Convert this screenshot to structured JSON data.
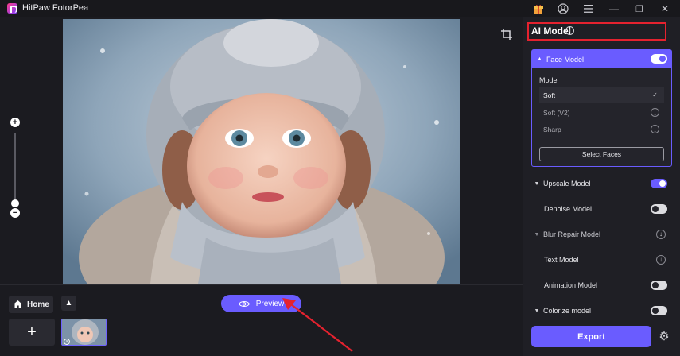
{
  "window": {
    "title": "HitPaw FotorPea",
    "minimize_glyph": "—",
    "restore_glyph": "❐",
    "close_glyph": "✕"
  },
  "canvas": {
    "zoom_in_glyph": "+",
    "zoom_out_glyph": "−",
    "photo_alt": "child in knit hat"
  },
  "bottom": {
    "home_label": "Home",
    "up_glyph": "▲",
    "add_glyph": "+",
    "preview_label": "Preview"
  },
  "panel": {
    "title": "AI Model",
    "info_glyph": "i",
    "face_model": {
      "label": "Face Model",
      "enabled": true,
      "mode_label": "Mode",
      "modes": [
        {
          "label": "Soft",
          "selected": true,
          "icon": "check-icon",
          "glyph": "✓"
        },
        {
          "label": "Soft (V2)",
          "selected": false,
          "icon": "download-icon",
          "glyph": "↓"
        },
        {
          "label": "Sharp",
          "selected": false,
          "icon": "download-icon",
          "glyph": "↓"
        }
      ],
      "select_faces_label": "Select Faces"
    },
    "models": [
      {
        "label": "Upscale Model",
        "caret": "▼",
        "toggle": "on"
      },
      {
        "label": "Denoise Model",
        "toggle": "off"
      },
      {
        "label": "Blur Repair Model",
        "caret": "▼",
        "download": true
      },
      {
        "label": "Text Model",
        "download": true
      },
      {
        "label": "Animation Model",
        "toggle": "off"
      },
      {
        "label": "Colorize model",
        "caret": "▼",
        "toggle": "off"
      }
    ],
    "download_glyph": "↓",
    "export_label": "Export",
    "gear_glyph": "⚙"
  },
  "colors": {
    "accent": "#6a5cff",
    "highlight_box": "#e5222f",
    "annotation_arrow": "#e5222f"
  }
}
